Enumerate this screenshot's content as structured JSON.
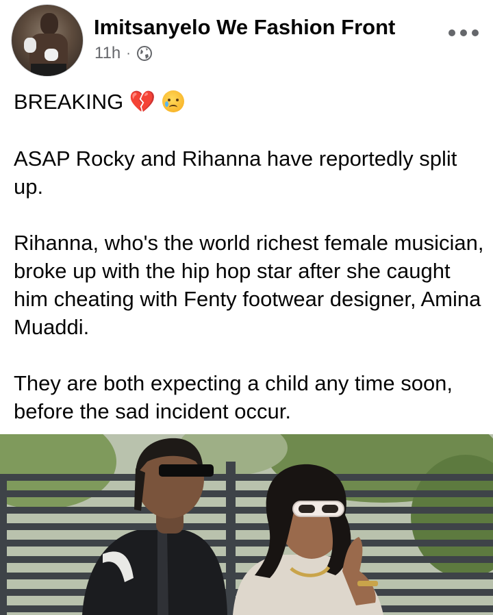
{
  "post": {
    "author": "Imitsanyelo We Fashion Front",
    "time": "11h",
    "separator": "·",
    "privacy_icon": "globe-icon",
    "more_icon": "more-options-icon",
    "paragraphs": [
      "BREAKING",
      "ASAP Rocky and Rihanna have reportedly split up.",
      "Rihanna, who's the world richest female musician, broke up with the hip hop star after she caught him cheating with Fenty footwear designer, Amina Muaddi.",
      "They are both expecting a child any time soon, before the sad incident occur."
    ],
    "breaking_emojis": [
      "💔",
      "😥"
    ]
  },
  "colors": {
    "text": "#050505",
    "meta": "#65676b",
    "background": "#ffffff"
  }
}
